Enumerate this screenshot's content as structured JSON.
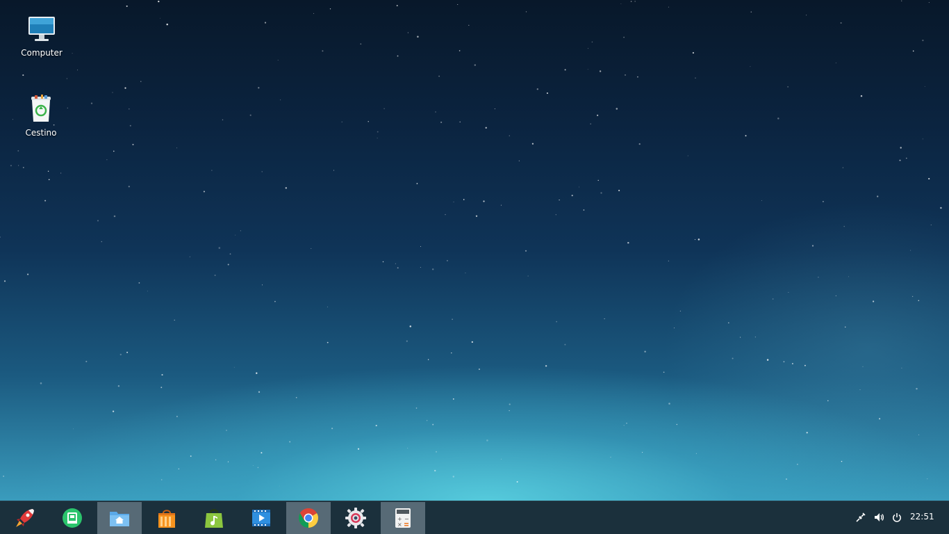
{
  "desktop": {
    "icons": [
      {
        "label": "Computer",
        "icon": "computer-icon"
      },
      {
        "label": "Cestino",
        "icon": "trash-icon"
      }
    ]
  },
  "taskbar": {
    "dock": [
      {
        "name": "launcher",
        "icon": "rocket-icon",
        "active": false
      },
      {
        "name": "deepin-store-alt",
        "icon": "green-app-icon",
        "active": false
      },
      {
        "name": "file-manager",
        "icon": "folder-home-icon",
        "active": true
      },
      {
        "name": "app-store",
        "icon": "shopping-bag-icon",
        "active": false
      },
      {
        "name": "music-player",
        "icon": "music-bag-icon",
        "active": false
      },
      {
        "name": "video-player",
        "icon": "video-icon",
        "active": false
      },
      {
        "name": "chrome",
        "icon": "chrome-icon",
        "active": true
      },
      {
        "name": "settings",
        "icon": "gear-icon",
        "active": false
      },
      {
        "name": "calculator",
        "icon": "calculator-icon",
        "active": true
      }
    ],
    "tray": [
      {
        "name": "network",
        "icon": "network-icon"
      },
      {
        "name": "volume",
        "icon": "volume-icon"
      },
      {
        "name": "power",
        "icon": "power-icon"
      }
    ],
    "clock": "22:51"
  },
  "colors": {
    "taskbar_bg": "#12283a",
    "active_slot": "#8fa3ad",
    "desktop_top": "#08182a",
    "desktop_bottom": "#3a9cbd"
  }
}
